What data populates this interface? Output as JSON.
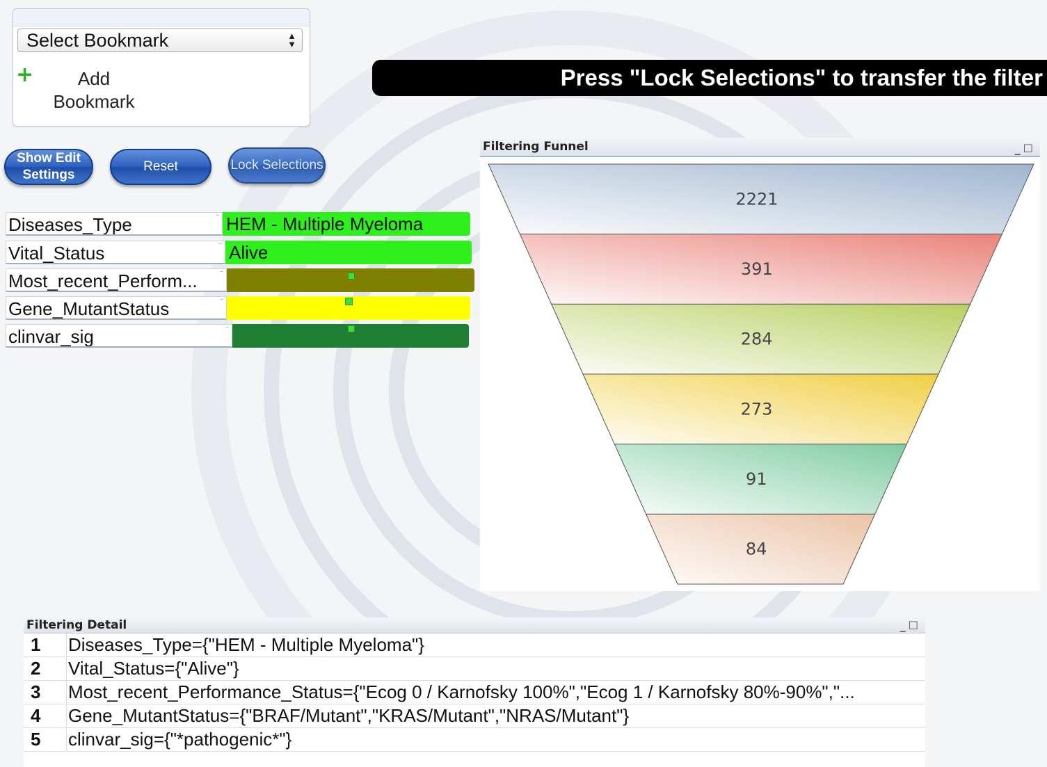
{
  "bookmark": {
    "select_value": "Select Bookmark",
    "add_label": "Add Bookmark"
  },
  "banner": {
    "text": "Press \"Lock Selections\" to transfer the filter"
  },
  "buttons": {
    "show_edit": "Show Edit Settings",
    "reset": "Reset",
    "lock": "Lock Selections"
  },
  "listboxes": [
    {
      "field": "Diseases_Type",
      "value": "HEM - Multiple Myeloma",
      "color": "#2ff01d"
    },
    {
      "field": "Vital_Status",
      "value": "Alive",
      "color": "#2ff01d"
    },
    {
      "field": "Most_recent_Perform...",
      "value": "",
      "color": "#808000"
    },
    {
      "field": "Gene_MutantStatus",
      "value": "",
      "color": "#ffff00"
    },
    {
      "field": "clinvar_sig",
      "value": "",
      "color": "#1e7f32"
    }
  ],
  "funnel": {
    "title": "Filtering Funnel",
    "chart_data": {
      "type": "funnel",
      "values": [
        2221,
        391,
        284,
        273,
        91,
        84
      ],
      "colors": [
        "#9fb5cf",
        "#e9837a",
        "#b9cf62",
        "#f0cf45",
        "#7fcca3",
        "#ebc3a6"
      ]
    }
  },
  "detail": {
    "title": "Filtering Detail",
    "rows": [
      {
        "num": "1",
        "text": "Diseases_Type={\"HEM - Multiple Myeloma\"}"
      },
      {
        "num": "2",
        "text": "Vital_Status={\"Alive\"}"
      },
      {
        "num": "3",
        "text": "Most_recent_Performance_Status={\"Ecog 0 / Karnofsky 100%\",\"Ecog 1 / Karnofsky 80%-90%\",\"..."
      },
      {
        "num": "4",
        "text": "Gene_MutantStatus={\"BRAF/Mutant\",\"KRAS/Mutant\",\"NRAS/Mutant\"}"
      },
      {
        "num": "5",
        "text": "clinvar_sig={\"*pathogenic*\"}"
      }
    ]
  }
}
